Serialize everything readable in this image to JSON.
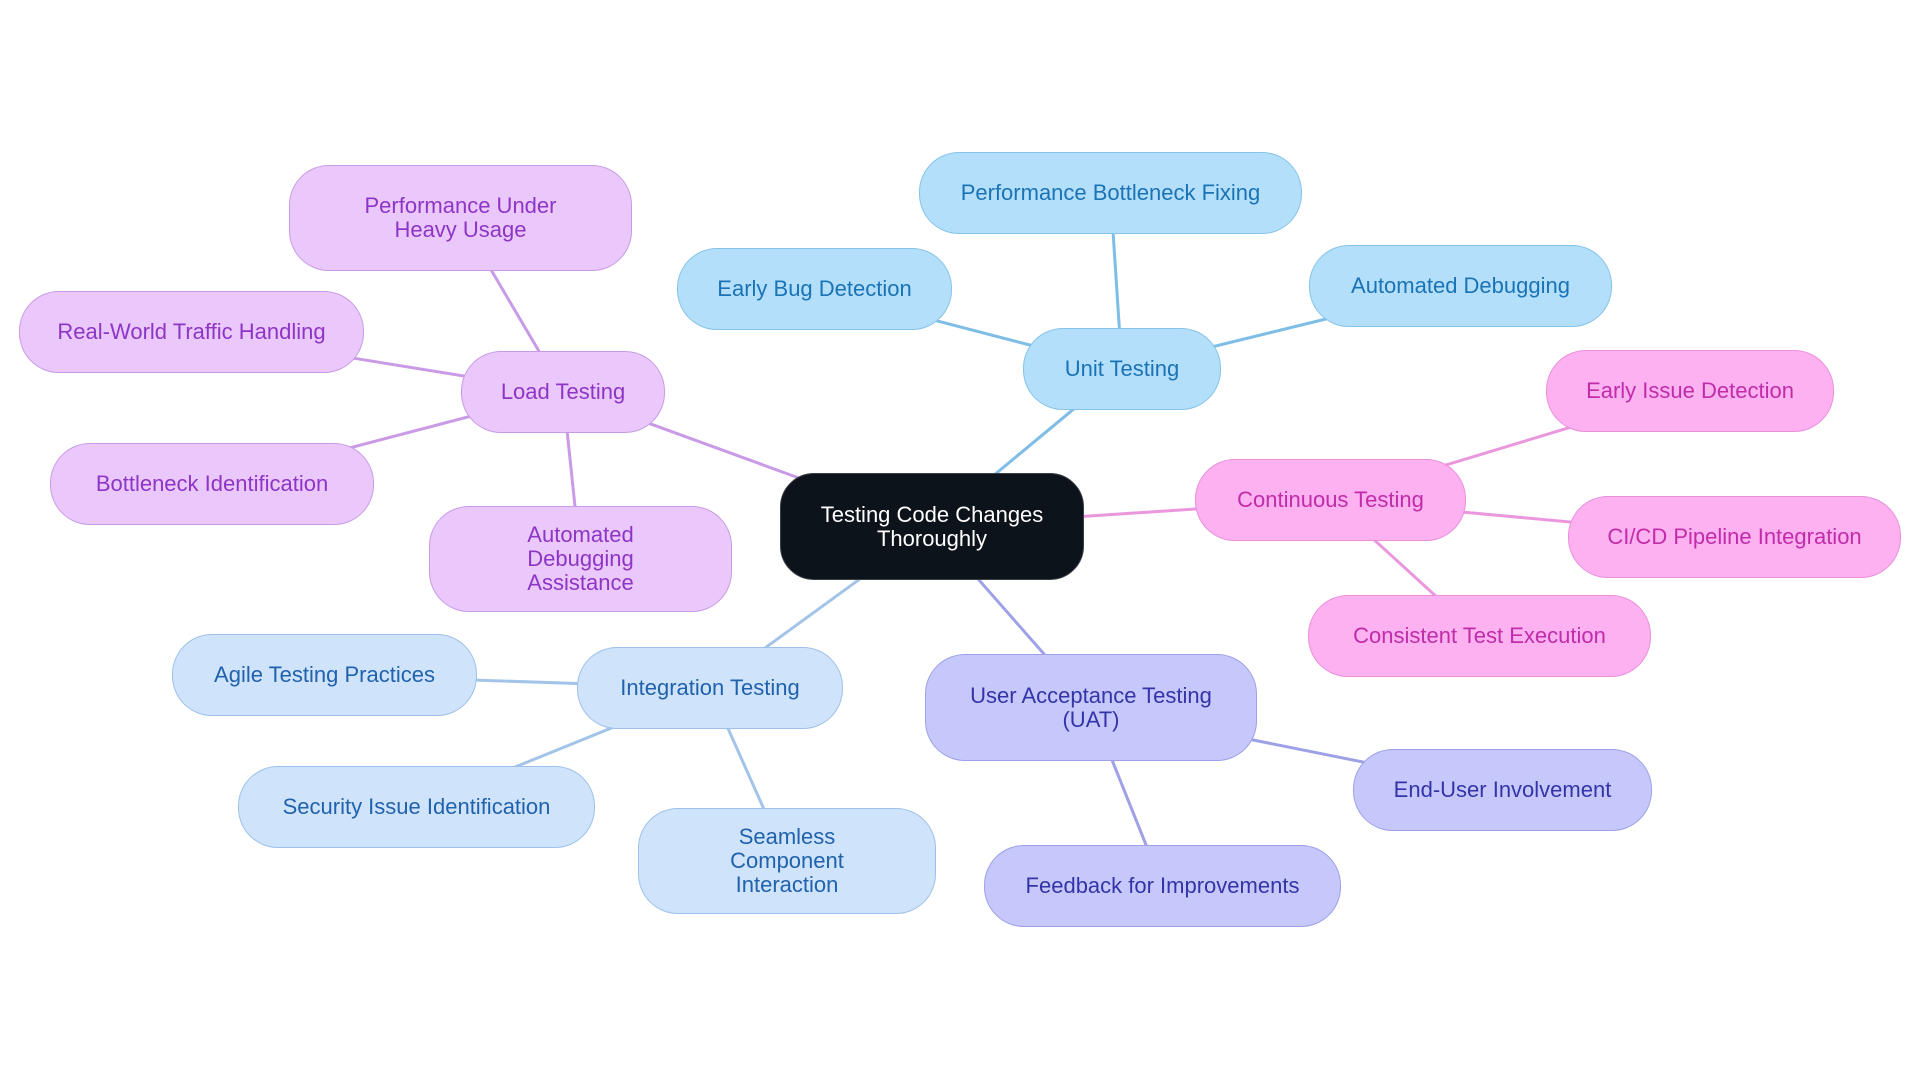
{
  "diagram": {
    "type": "mind-map",
    "root": {
      "id": "root",
      "label": "Testing Code Changes Thoroughly"
    },
    "branches": [
      {
        "id": "unit",
        "label": "Unit Testing",
        "color": "#b3dffb",
        "edge_color": "#7dbde6",
        "children": [
          {
            "id": "unit-1",
            "label": "Early Bug Detection"
          },
          {
            "id": "unit-2",
            "label": "Performance Bottleneck Fixing"
          },
          {
            "id": "unit-3",
            "label": "Automated Debugging"
          }
        ]
      },
      {
        "id": "load",
        "label": "Load Testing",
        "color": "#eac8fb",
        "edge_color": "#c99be6",
        "children": [
          {
            "id": "load-1",
            "label": "Performance Under Heavy Usage"
          },
          {
            "id": "load-2",
            "label": "Real-World Traffic Handling"
          },
          {
            "id": "load-3",
            "label": "Bottleneck Identification"
          },
          {
            "id": "load-4",
            "label": "Automated Debugging Assistance"
          }
        ]
      },
      {
        "id": "cont",
        "label": "Continuous Testing",
        "color": "#fdb1f1",
        "edge_color": "#eb97de",
        "children": [
          {
            "id": "cont-1",
            "label": "Early Issue Detection"
          },
          {
            "id": "cont-2",
            "label": "CI/CD Pipeline Integration"
          },
          {
            "id": "cont-3",
            "label": "Consistent Test Execution"
          }
        ]
      },
      {
        "id": "uat",
        "label": "User Acceptance Testing (UAT)",
        "color": "#c6c8fc",
        "edge_color": "#9fa1e6",
        "children": [
          {
            "id": "uat-1",
            "label": "End-User Involvement"
          },
          {
            "id": "uat-2",
            "label": "Feedback for Improvements"
          }
        ]
      },
      {
        "id": "int",
        "label": "Integration Testing",
        "color": "#cfe3fb",
        "edge_color": "#a3c4e8",
        "children": [
          {
            "id": "int-1",
            "label": "Agile Testing Practices"
          },
          {
            "id": "int-2",
            "label": "Security Issue Identification"
          },
          {
            "id": "int-3",
            "label": "Seamless Component Interaction"
          }
        ]
      }
    ]
  }
}
